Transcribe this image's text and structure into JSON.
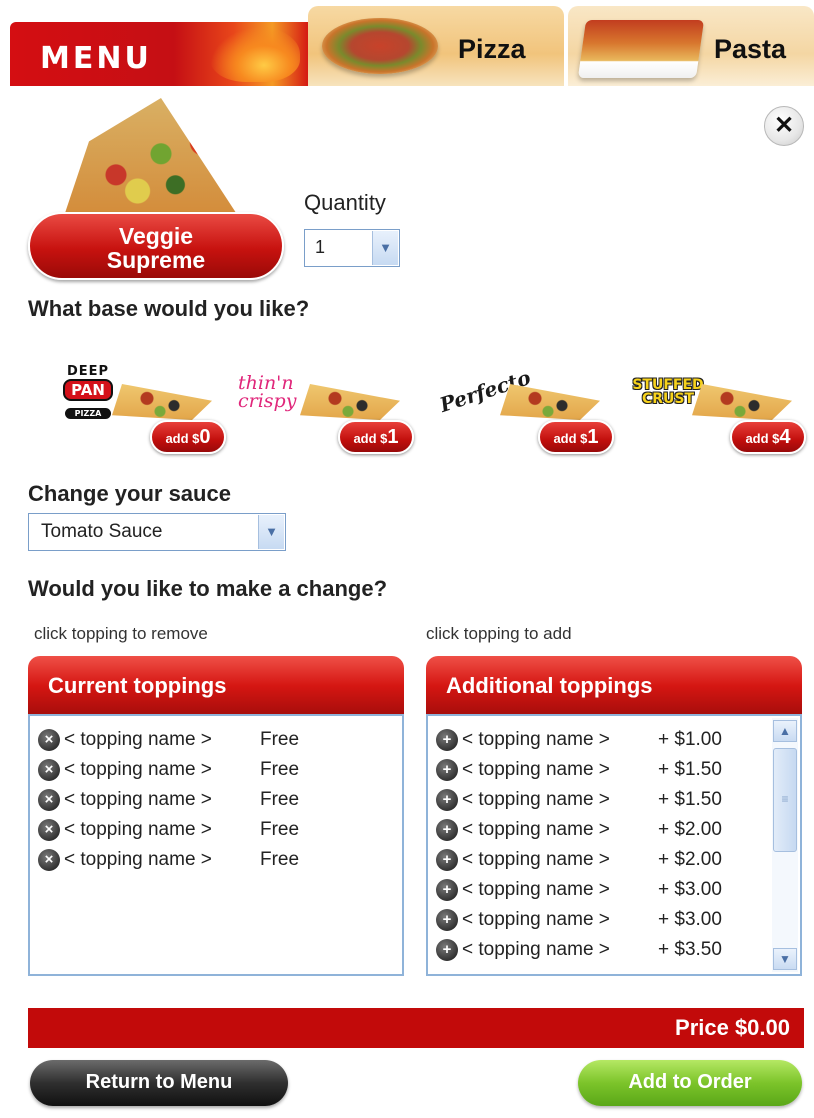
{
  "tabs": {
    "menu_label": "MENU",
    "pizza_label": "Pizza",
    "pasta_label": "Pasta"
  },
  "product": {
    "name_line1": "Veggie",
    "name_line2": "Supreme",
    "quantity_label": "Quantity",
    "quantity_value": "1"
  },
  "base": {
    "heading": "What base would you like?",
    "options": [
      {
        "logo_line1": "DEEP",
        "logo_line2": "PAN",
        "logo_line3": "PIZZA",
        "add_prefix": "add $",
        "add_amount": "0"
      },
      {
        "logo_line1": "thin'n",
        "logo_line2": "crispy",
        "add_prefix": "add $",
        "add_amount": "1"
      },
      {
        "logo_line1": "Perfecto",
        "add_prefix": "add $",
        "add_amount": "1"
      },
      {
        "logo_line1": "STUFFED",
        "logo_line2": "CRUST",
        "add_prefix": "add $",
        "add_amount": "4"
      }
    ]
  },
  "sauce": {
    "heading": "Change your sauce",
    "selected": "Tomato Sauce"
  },
  "change": {
    "heading": "Would you like to make a change?",
    "remove_hint": "click topping to remove",
    "add_hint": "click topping to add"
  },
  "current_toppings": {
    "title": "Current toppings",
    "items": [
      {
        "name": "< topping name >",
        "price": "Free"
      },
      {
        "name": "< topping name >",
        "price": "Free"
      },
      {
        "name": "< topping name >",
        "price": "Free"
      },
      {
        "name": "< topping name >",
        "price": "Free"
      },
      {
        "name": "< topping name >",
        "price": "Free"
      }
    ]
  },
  "additional_toppings": {
    "title": "Additional toppings",
    "items": [
      {
        "name": "< topping name >",
        "price": "+ $1.00"
      },
      {
        "name": "< topping name >",
        "price": "+ $1.50"
      },
      {
        "name": "< topping name >",
        "price": "+ $1.50"
      },
      {
        "name": "< topping name >",
        "price": "+ $2.00"
      },
      {
        "name": "< topping name >",
        "price": "+ $2.00"
      },
      {
        "name": "< topping name >",
        "price": "+ $3.00"
      },
      {
        "name": "< topping name >",
        "price": "+ $3.00"
      },
      {
        "name": "< topping name >",
        "price": "+ $3.50"
      }
    ]
  },
  "footer": {
    "price_label": "Price $0.00",
    "return_label": "Return to Menu",
    "add_label": "Add to Order"
  },
  "icons": {
    "close": "close-icon",
    "remove": "remove-topping-icon",
    "add": "add-topping-icon",
    "dropdown": "chevron-down-icon",
    "scroll_up": "scroll-up-icon",
    "scroll_down": "scroll-down-icon"
  },
  "colors": {
    "brand_red": "#c20a0a",
    "add_green": "#7cc42a",
    "tab_tan": "#f1c47c",
    "field_border": "#7a9ec9"
  }
}
